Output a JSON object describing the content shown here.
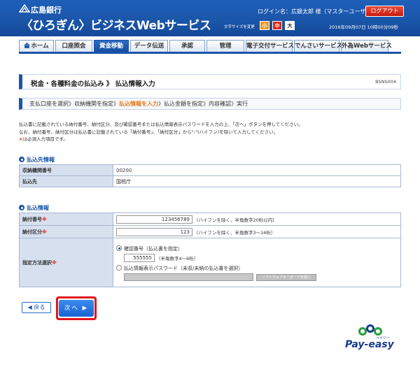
{
  "header": {
    "bank_name": "広島銀行",
    "service_name": "〈ひろぎん〉ビジネスWebサービス",
    "login_text": "ログイン名：広銀太郎 様（マスターユーザ）",
    "logout_label": "ログアウト",
    "font_size_label": "文字サイズを変更",
    "font_small": "小",
    "font_medium": "中",
    "font_large": "大",
    "datetime": "2016年09月07日 10時00分09秒"
  },
  "nav": {
    "home": "ホーム",
    "account_inquiry": "口座照会",
    "fund_transfer": "資金移動",
    "data_transmission": "データ伝送",
    "approval": "承認",
    "management": "管理",
    "electronic_delivery": "電子交付サービス",
    "densai": "でんさいサービス",
    "forex": "外為Webサービス"
  },
  "page": {
    "title": "税金・各種料金の払込み 》 払込情報入力",
    "screen_id": "BSNS004"
  },
  "steps": {
    "s1": "支払口座を選択",
    "s2": "収納機関を指定",
    "s3": "払込情報を入力",
    "s4": "払込金額を指定",
    "s5": "内容確認",
    "s6": "実行",
    "sep": "》"
  },
  "description": {
    "line1": "払込書に記載されている納付番号、納付区分、及び確認番号または払込情報表示パスワードを入力の上、「次へ」ボタンを押してください。",
    "line2": "なお、納付番号、納付区分は払込書に記載されている「納付番号」、「納付区分」から\"-\"(ハイフン)を除いて入力してください。",
    "required_mark": "※",
    "line3": "は必須入力項目です。"
  },
  "payee_section": {
    "heading": "払込先情報",
    "rows": [
      {
        "label": "収納機関番号",
        "value": "00200"
      },
      {
        "label": "払込先",
        "value": "国税庁"
      }
    ]
  },
  "payment_section": {
    "heading": "払込情報",
    "payment_number_label": "納付番号",
    "payment_number_value": "123456789",
    "payment_number_hint": "（ハイフンを除く、半角数字20桁以内）",
    "payment_category_label": "納付区分",
    "payment_category_value": "123",
    "payment_category_hint": "（ハイフンを除く、半角数字3～16桁）",
    "method_label": "指定方法選択",
    "option_confirm": "確認番号（払込書を指定）",
    "confirm_number_value": "555555",
    "confirm_number_hint": "（半角数字4～6桁）",
    "option_password": "払込情報表示パスワード（未収/未納の払込書を選択）",
    "soft_keyboard": "ソフトウェアキーボードを開く",
    "required_mark": "※"
  },
  "buttons": {
    "back": "戻る",
    "next": "次へ"
  },
  "payeasy": {
    "logo": "Pay-easy",
    "kana": "ペイジー"
  },
  "colors": {
    "header_blue": "#1a55a8",
    "accent_orange": "#e8771a",
    "required_red": "#e0241a",
    "logout_red": "#d62d1e"
  }
}
